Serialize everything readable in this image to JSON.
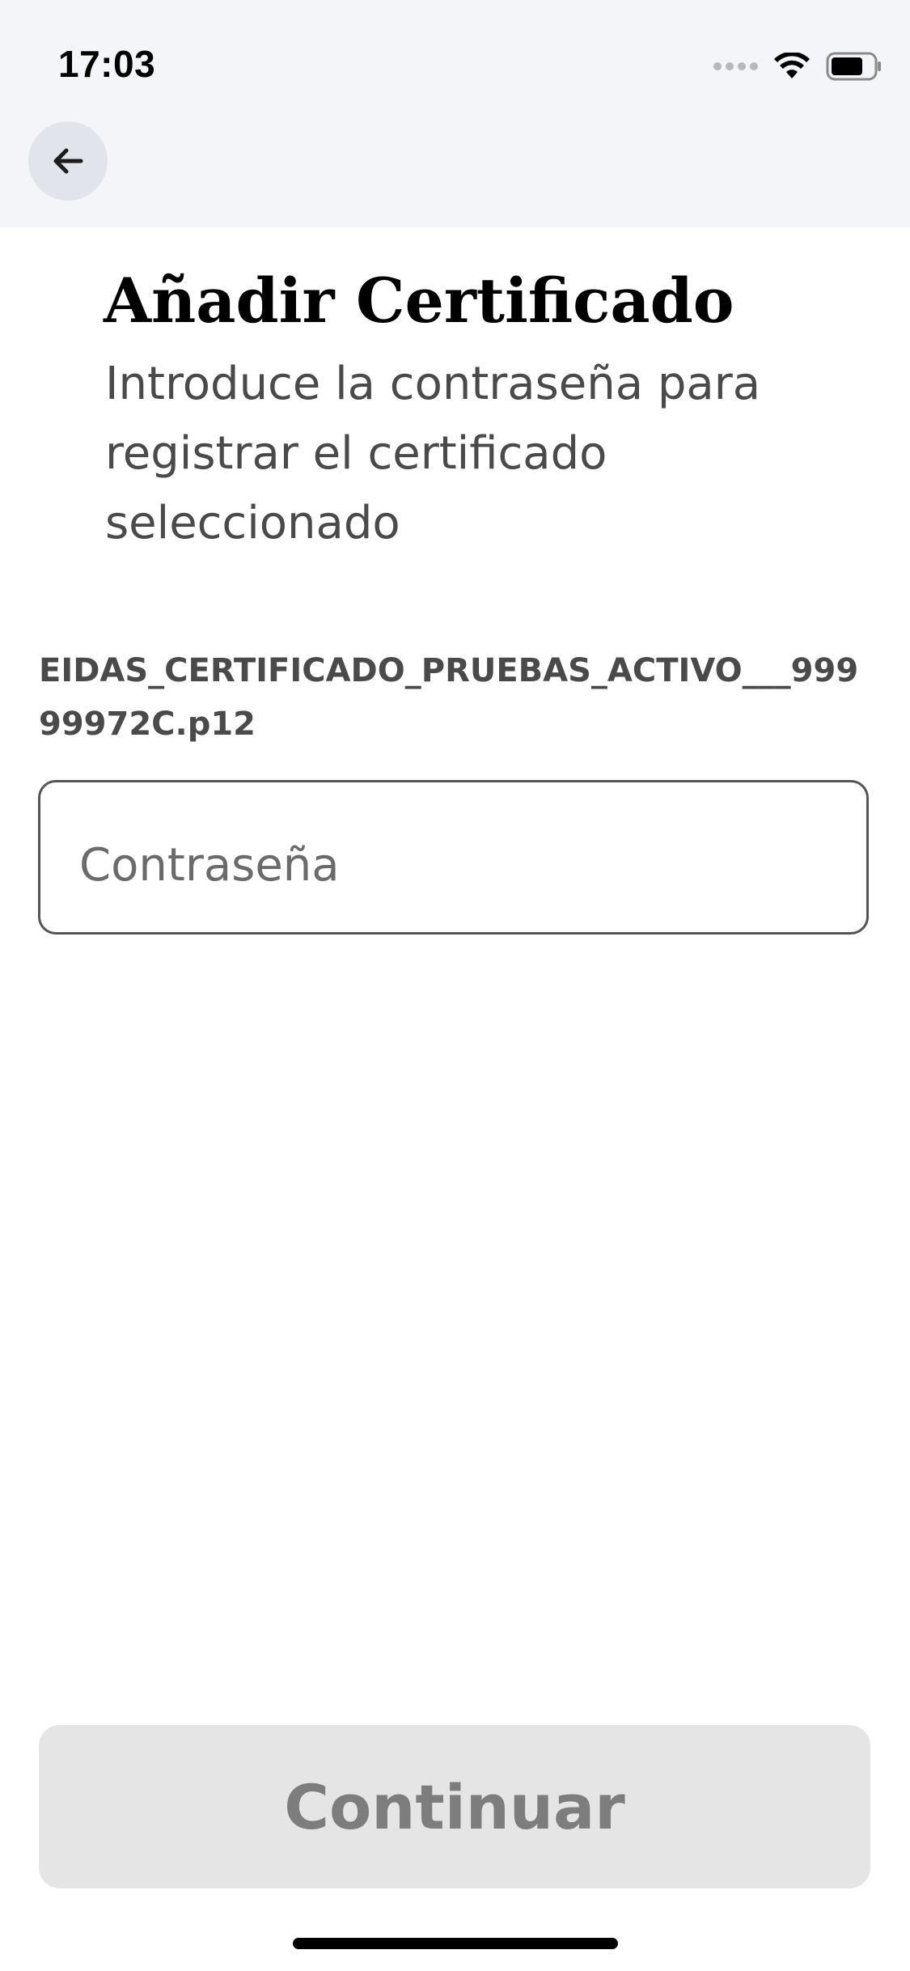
{
  "status_bar": {
    "time": "17:03",
    "icons": [
      "cellular-signal-icon",
      "wifi-icon",
      "battery-icon"
    ]
  },
  "nav": {
    "back_icon": "arrow-left-icon"
  },
  "header": {
    "title": "Añadir Certificado",
    "subtitle": "Introduce la contraseña para registrar el certificado seleccionado"
  },
  "certificate": {
    "file_name": "EIDAS_CERTIFICADO_PRUEBAS_ACTIVO___99999972C.p12"
  },
  "password": {
    "placeholder": "Contraseña",
    "value": ""
  },
  "actions": {
    "continue_label": "Continuar"
  },
  "colors": {
    "top_background": "#f4f5f9",
    "back_button_bg": "#e1e4ea",
    "text_secondary": "#4a4a4a",
    "field_border": "#555555",
    "button_disabled_bg": "#e5e5e5",
    "button_disabled_text": "#7d7d7d"
  }
}
